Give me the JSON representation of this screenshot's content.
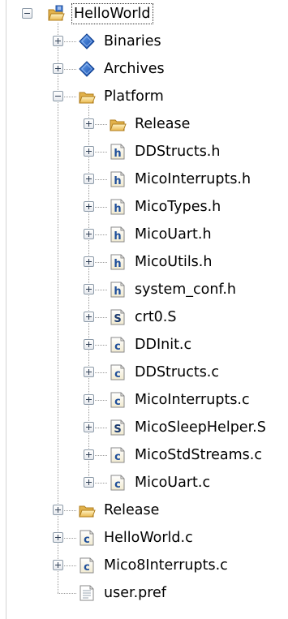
{
  "project_tree": {
    "root": {
      "label": "HelloWorld",
      "icon": "project-folder-icon"
    },
    "binaries": {
      "label": "Binaries",
      "icon": "diamond-icon"
    },
    "archives": {
      "label": "Archives",
      "icon": "diamond-icon"
    },
    "platform": {
      "label": "Platform",
      "icon": "open-folder-icon",
      "children": [
        {
          "label": "Release",
          "icon": "open-folder-icon"
        },
        {
          "label": "DDStructs.h",
          "icon": "header-file-icon"
        },
        {
          "label": "MicoInterrupts.h",
          "icon": "header-file-icon"
        },
        {
          "label": "MicoTypes.h",
          "icon": "header-file-icon"
        },
        {
          "label": "MicoUart.h",
          "icon": "header-file-icon"
        },
        {
          "label": "MicoUtils.h",
          "icon": "header-file-icon"
        },
        {
          "label": "system_conf.h",
          "icon": "header-file-icon"
        },
        {
          "label": "crt0.S",
          "icon": "assembly-file-icon"
        },
        {
          "label": "DDInit.c",
          "icon": "c-file-icon"
        },
        {
          "label": "DDStructs.c",
          "icon": "c-file-icon"
        },
        {
          "label": "MicoInterrupts.c",
          "icon": "c-file-icon"
        },
        {
          "label": "MicoSleepHelper.S",
          "icon": "assembly-file-icon"
        },
        {
          "label": "MicoStdStreams.c",
          "icon": "c-file-icon"
        },
        {
          "label": "MicoUart.c",
          "icon": "c-file-icon"
        }
      ]
    },
    "release": {
      "label": "Release",
      "icon": "open-folder-icon"
    },
    "helloworld_c": {
      "label": "HelloWorld.c",
      "icon": "c-file-icon"
    },
    "mico8interrupts_c": {
      "label": "Mico8Interrupts.c",
      "icon": "c-file-icon"
    },
    "user_pref": {
      "label": "user.pref",
      "icon": "text-file-icon"
    }
  },
  "icon_glyphs": {
    "header-file": "h",
    "c-file": "c",
    "assembly-file": "S"
  },
  "colors": {
    "folder": "#f3c968",
    "diamond": "#1f63c9",
    "file_letter": "#1f4f9a",
    "assembly_letter": "#1a3a70"
  }
}
